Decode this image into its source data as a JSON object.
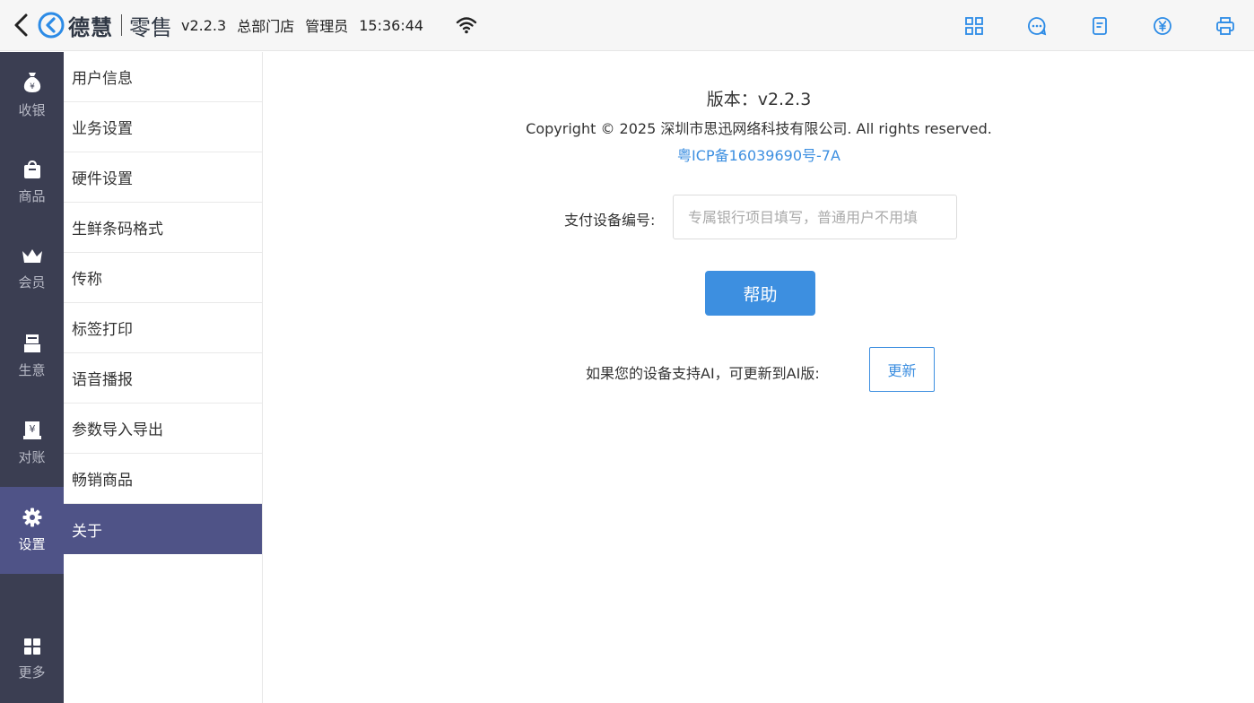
{
  "topbar": {
    "brand": "德慧",
    "product": "零售",
    "version": "v2.2.3",
    "store": "总部门店",
    "role": "管理员",
    "time": "15:36:44",
    "icons": [
      "grid-icon",
      "chat-icon",
      "document-icon",
      "yuan-icon",
      "printer-icon"
    ]
  },
  "leftnav": {
    "items": [
      {
        "label": "收银",
        "icon": "money-bag-icon"
      },
      {
        "label": "商品",
        "icon": "shopping-bag-icon"
      },
      {
        "label": "会员",
        "icon": "crown-icon"
      },
      {
        "label": "生意",
        "icon": "register-icon"
      },
      {
        "label": "对账",
        "icon": "ledger-icon"
      },
      {
        "label": "设置",
        "icon": "gear-icon",
        "active": true
      },
      {
        "label": "更多",
        "icon": "apps-icon"
      }
    ]
  },
  "submenu": {
    "items": [
      "用户信息",
      "业务设置",
      "硬件设置",
      "生鲜条码格式",
      "传称",
      "标签打印",
      "语音播报",
      "参数导入导出",
      "畅销商品",
      "关于"
    ],
    "active_index": 9
  },
  "about": {
    "version_text": "版本：v2.2.3",
    "copyright": "Copyright © 2025 深圳市思迅网络科技有限公司. All rights reserved.",
    "icp": "粤ICP备16039690号-7A",
    "pay_device_label": "支付设备编号:",
    "pay_device_value": "",
    "pay_device_placeholder": "专属银行项目填写，普通用户不用填",
    "help_label": "帮助",
    "ai_prompt": "如果您的设备支持AI，可更新到AI版:",
    "update_label": "更新"
  },
  "colors": {
    "accent": "#3d8fe0",
    "nav_bg": "#3b3e52",
    "active_bg": "#4f5387"
  }
}
